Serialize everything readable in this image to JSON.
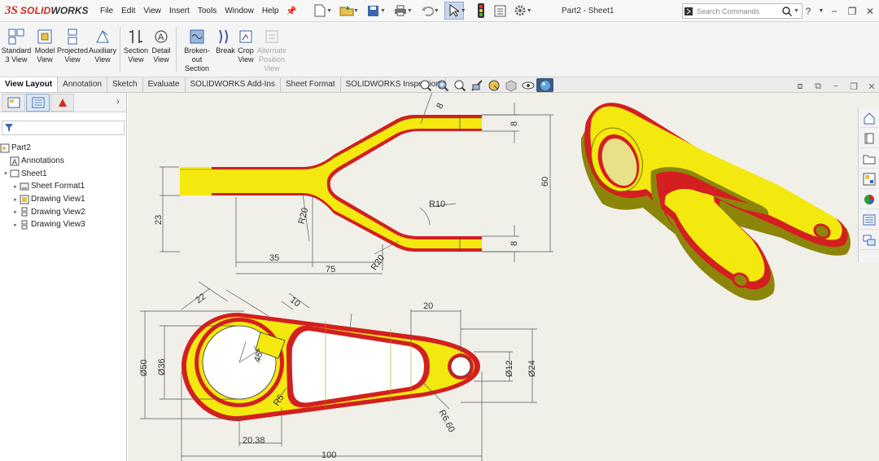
{
  "app": {
    "logo_ds": "3S",
    "logo_solid": "SOLID",
    "logo_works": "WORKS"
  },
  "menus": [
    "File",
    "Edit",
    "View",
    "Insert",
    "Tools",
    "Window",
    "Help"
  ],
  "document_title": "Part2 - Sheet1",
  "search": {
    "placeholder": "Search Commands"
  },
  "ribbon": {
    "buttons": [
      {
        "line1": "Standard",
        "line2": "3 View"
      },
      {
        "line1": "Model",
        "line2": "View"
      },
      {
        "line1": "Projected",
        "line2": "View"
      },
      {
        "line1": "Auxiliary",
        "line2": "View"
      },
      {
        "line1": "Section",
        "line2": "View"
      },
      {
        "line1": "Detail",
        "line2": "View"
      },
      {
        "line1": "Broken-out",
        "line2": "Section"
      },
      {
        "line1": "Break",
        "line2": ""
      },
      {
        "line1": "Crop",
        "line2": "View"
      },
      {
        "line1": "Alternate",
        "line2": "Position",
        "line3": "View"
      }
    ]
  },
  "command_tabs": [
    "View Layout",
    "Annotation",
    "Sketch",
    "Evaluate",
    "SOLIDWORKS Add-Ins",
    "Sheet Format",
    "SOLIDWORKS Inspection"
  ],
  "tree": {
    "root": "Part2",
    "annotations": "Annotations",
    "sheet": "Sheet1",
    "children": [
      "Sheet Format1",
      "Drawing View1",
      "Drawing View2",
      "Drawing View3"
    ]
  },
  "dimensions": {
    "top": {
      "d8_angled": "8",
      "d8_right_top": "8",
      "d60": "60",
      "d8_right_bottom": "8",
      "d23": "23",
      "d35": "35",
      "d75": "75",
      "r20_a": "R20",
      "r10": "R10",
      "r20_b": "R20"
    },
    "bottom": {
      "d22": "22",
      "d10": "10",
      "d20": "20",
      "d50": "Ø50",
      "d36": "Ø36",
      "a45": "45°",
      "r5": "R5",
      "r660": "R6.60",
      "d12": "Ø12",
      "d24": "Ø24",
      "d2038": "20.38",
      "d100": "100"
    }
  },
  "colors": {
    "part_yellow": "#f3e90f",
    "part_red": "#d31f1f",
    "sheet_bg": "#f1f0e8"
  }
}
